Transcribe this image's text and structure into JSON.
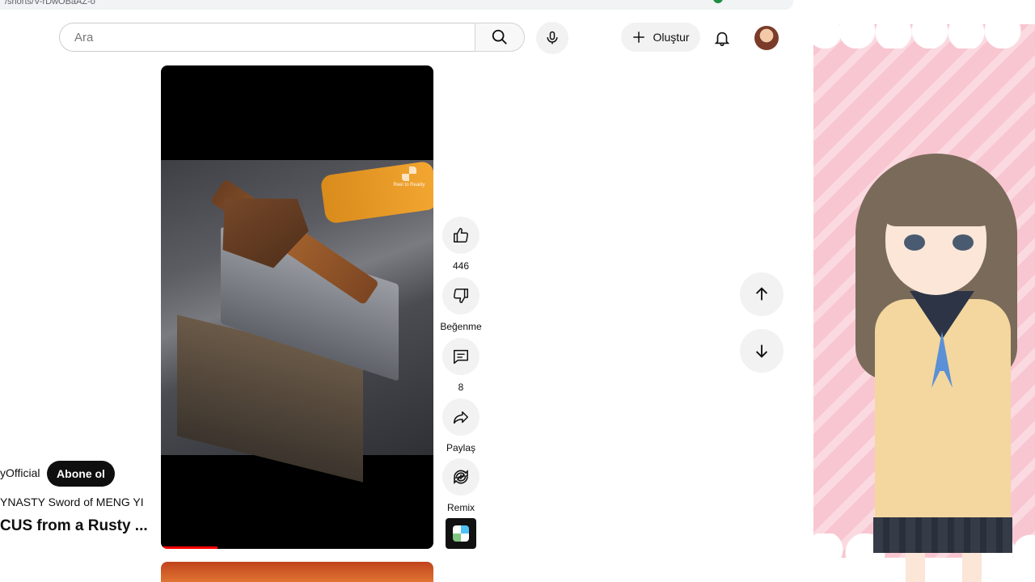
{
  "browser": {
    "url": "/shorts/V-rDwOBaAZ-o"
  },
  "header": {
    "search_placeholder": "Ara",
    "create_label": "Oluştur"
  },
  "actions": {
    "like_count": "446",
    "dislike_label": "Beğenme",
    "comment_count": "8",
    "share_label": "Paylaş",
    "remix_label": "Remix"
  },
  "video_overlay": {
    "watermark": "Reel to Reality",
    "channel_name": "yOfficial",
    "subscribe_label": "Abone ol",
    "sound_title": "YNASTY Sword of MENG YI",
    "video_title": "CUS from a Rusty ..."
  },
  "colors": {
    "subscribe_bg": "#0f0f0f",
    "progress": "#ff0000",
    "panel_pink": "#f8c6d0"
  }
}
